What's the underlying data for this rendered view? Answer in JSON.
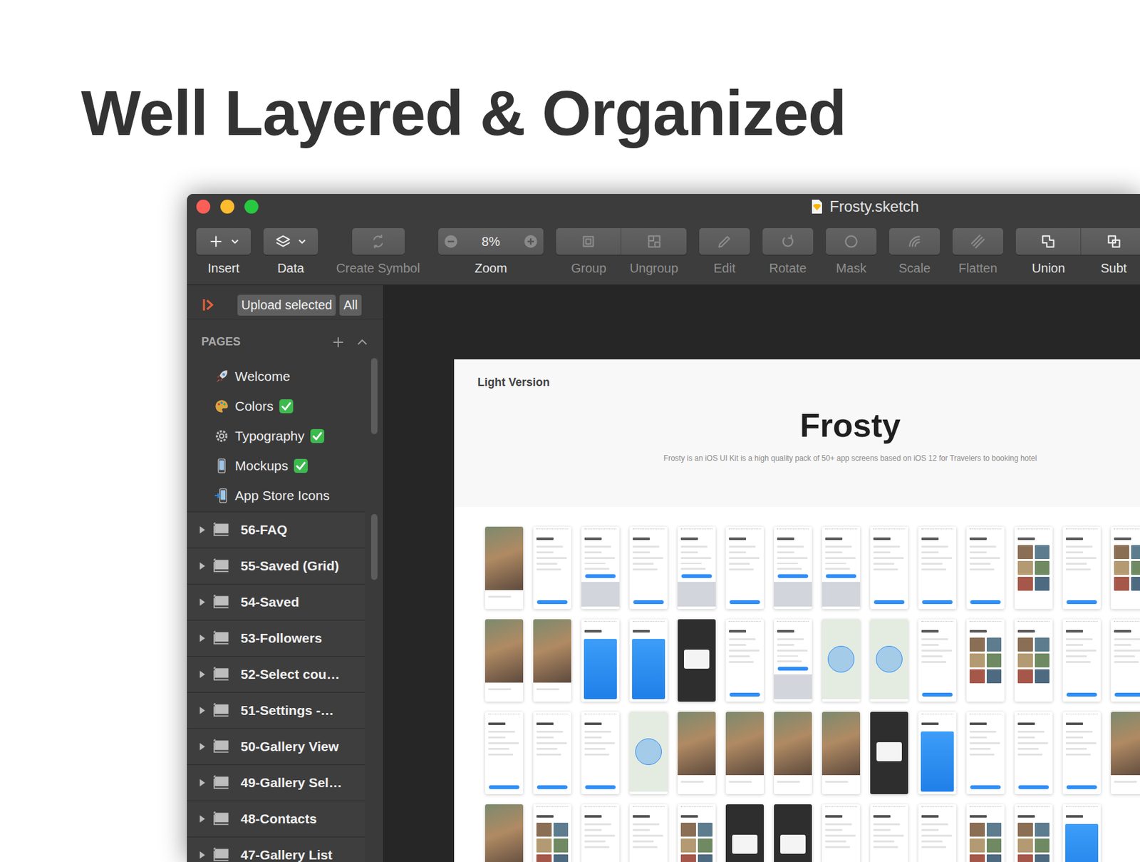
{
  "headline": "Well Layered & Organized",
  "window": {
    "title": "Frosty.sketch"
  },
  "toolbar": [
    {
      "label": "Insert",
      "kind": "menu",
      "disabled": false
    },
    {
      "label": "Data",
      "kind": "menu",
      "disabled": false
    },
    {
      "label": "Create Symbol",
      "kind": "wide",
      "disabled": true
    },
    {
      "label": "Zoom",
      "kind": "zoom",
      "value": "8%",
      "disabled": false
    },
    {
      "label": "Group",
      "kind": "segment-left",
      "disabled": true
    },
    {
      "label": "Ungroup",
      "kind": "segment-right",
      "disabled": true
    },
    {
      "label": "Edit",
      "kind": "button",
      "disabled": true
    },
    {
      "label": "Rotate",
      "kind": "button",
      "disabled": true
    },
    {
      "label": "Mask",
      "kind": "button",
      "disabled": true
    },
    {
      "label": "Scale",
      "kind": "button",
      "disabled": true
    },
    {
      "label": "Flatten",
      "kind": "button",
      "disabled": true
    },
    {
      "label": "Union",
      "kind": "segment-left",
      "disabled": false
    },
    {
      "label": "Subt",
      "kind": "segment-right",
      "disabled": false
    }
  ],
  "plugin": {
    "buttons": [
      "Upload selected",
      "All"
    ]
  },
  "pages": {
    "title": "PAGES",
    "items": [
      {
        "label": "Welcome",
        "checked": false
      },
      {
        "label": "Colors",
        "checked": true
      },
      {
        "label": "Typography",
        "checked": true
      },
      {
        "label": "Mockups",
        "checked": true
      },
      {
        "label": "App Store Icons",
        "checked": false
      }
    ]
  },
  "layers": [
    {
      "label": "56-FAQ",
      "expanded": false
    },
    {
      "label": "55-Saved (Grid)",
      "expanded": false
    },
    {
      "label": "54-Saved",
      "expanded": false
    },
    {
      "label": "53-Followers",
      "expanded": false
    },
    {
      "label": "52-Select cou…",
      "expanded": false
    },
    {
      "label": "51-Settings -…",
      "expanded": false
    },
    {
      "label": "50-Gallery View",
      "expanded": false
    },
    {
      "label": "49-Gallery Sel…",
      "expanded": false
    },
    {
      "label": "48-Contacts",
      "expanded": false
    },
    {
      "label": "47-Gallery List",
      "expanded": false
    }
  ],
  "artboard": {
    "label": "Light Version",
    "title": "Frosty",
    "subtitle": "Frosty is an iOS UI Kit is a high quality pack of 50+ app screens based on iOS 12 for Travelers to booking hotel",
    "screens": [
      [
        {
          "kind": "photo"
        },
        {
          "kind": "light"
        },
        {
          "kind": "keyboard"
        },
        {
          "kind": "light"
        },
        {
          "kind": "keyboard"
        },
        {
          "kind": "light"
        },
        {
          "kind": "keyboard"
        },
        {
          "kind": "keyboard"
        },
        {
          "kind": "light"
        },
        {
          "kind": "light"
        },
        {
          "kind": "light"
        },
        {
          "kind": "grid"
        },
        {
          "kind": "light"
        },
        {
          "kind": "grid"
        }
      ],
      [
        {
          "kind": "photo"
        },
        {
          "kind": "photo"
        },
        {
          "kind": "blue"
        },
        {
          "kind": "blue"
        },
        {
          "kind": "dark"
        },
        {
          "kind": "light"
        },
        {
          "kind": "keyboard"
        },
        {
          "kind": "map"
        },
        {
          "kind": "map"
        },
        {
          "kind": "light"
        },
        {
          "kind": "grid"
        },
        {
          "kind": "grid"
        },
        {
          "kind": "light"
        },
        {
          "kind": "light"
        }
      ],
      [
        {
          "kind": "light"
        },
        {
          "kind": "light"
        },
        {
          "kind": "light"
        },
        {
          "kind": "map"
        },
        {
          "kind": "photo"
        },
        {
          "kind": "photo"
        },
        {
          "kind": "photo"
        },
        {
          "kind": "photo"
        },
        {
          "kind": "dark"
        },
        {
          "kind": "blue"
        },
        {
          "kind": "light"
        },
        {
          "kind": "light"
        },
        {
          "kind": "light"
        },
        {
          "kind": "photo"
        }
      ],
      [
        {
          "kind": "photo"
        },
        {
          "kind": "grid"
        },
        {
          "kind": "light"
        },
        {
          "kind": "light"
        },
        {
          "kind": "grid"
        },
        {
          "kind": "dark"
        },
        {
          "kind": "dark"
        },
        {
          "kind": "light"
        },
        {
          "kind": "light"
        },
        {
          "kind": "light"
        },
        {
          "kind": "grid"
        },
        {
          "kind": "grid"
        },
        {
          "kind": "blue"
        }
      ]
    ]
  }
}
